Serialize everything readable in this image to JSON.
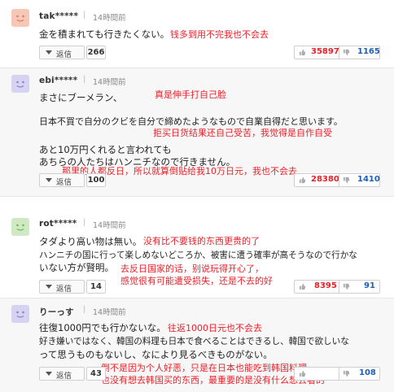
{
  "comments": [
    {
      "user": "tak*****",
      "separator": "|",
      "time": "14時間前",
      "avatar_color": "#f6c7b5",
      "face_color": "#e07a5f",
      "jp_lines": [
        "金を積まれても行きたくない。"
      ],
      "zh_notes": [
        "钱多到用不完我也不会去"
      ],
      "reply_label": "返信",
      "reply_count": "266",
      "good": "35897",
      "bad": "1165"
    },
    {
      "user": "ebi*****",
      "separator": "|",
      "time": "14時間前",
      "avatar_color": "#d6d2f2",
      "face_color": "#8a80d0",
      "jp_lines": [
        "まさにブーメラン、",
        "日本不買で自分のクビを自分で締めたようなもので自業自得だと思います。",
        "あと10万円くれると言われても",
        "あちらの人たちはハンニチなので行きません。"
      ],
      "zh_notes": [
        "真是伸手打自己脸",
        "拒买日货结果还自己受苦，我觉得是自作自受",
        "那里的人都反日，所以就算倒贴给我10万日元，我也不会去"
      ],
      "reply_label": "返信",
      "reply_count": "100",
      "good": "28380",
      "bad": "1410"
    },
    {
      "user": "rot*****",
      "separator": "|",
      "time": "14時間前",
      "avatar_color": "#cfe9c2",
      "face_color": "#6fb35a",
      "jp_lines": [
        "タダより高い物は無い。",
        "ハンニチの国に行って楽しめないどころか、被害に遭う確率が高そうなので行かな",
        "いない方が賢明。"
      ],
      "zh_notes": [
        "没有比不要钱的东西更贵的了",
        "去反日国家的话，别说玩得开心了，",
        "感觉很有可能遭受损失，还是不去的好"
      ],
      "reply_label": "返信",
      "reply_count": "14",
      "good": "8395",
      "bad": "91"
    },
    {
      "user": "りーっす",
      "separator": "|",
      "time": "14時間前",
      "avatar_color": "#d6d2f2",
      "face_color": "#8a80d0",
      "jp_lines": [
        "往復1000円でも行かないな。",
        "好き嫌いではなく、韓国の料理も日本で食べることはできるし、韓国で欲しいな",
        "って思うものもないし、なにより見るべきものがない。"
      ],
      "zh_notes": [
        "往返1000日元也不会去",
        "倒不是因为个人好恶，只是在日本也能吃到韩国料理",
        "也没有想去韩国买的东西，最重要的是没有什么想去看的"
      ],
      "reply_label": "返信",
      "reply_count": "43",
      "good": "",
      "bad": "108"
    }
  ]
}
